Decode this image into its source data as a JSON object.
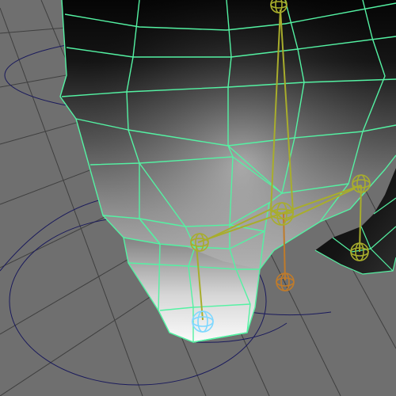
{
  "viewport": {
    "background_color": "#6f6f6f",
    "grid_color": "#3f3f3f",
    "mesh_wire_color": "#54f2a3",
    "mesh_fill_dark": "#050505",
    "mesh_fill_light": "#f3f3f3",
    "control_curve_color": "#1a1a5c",
    "selected_curve_color": "#e01818",
    "joint_color_yellow": "#a8ad2c",
    "joint_color_orange": "#c07b2a",
    "joint_color_cyan": "#7fd8ff"
  }
}
